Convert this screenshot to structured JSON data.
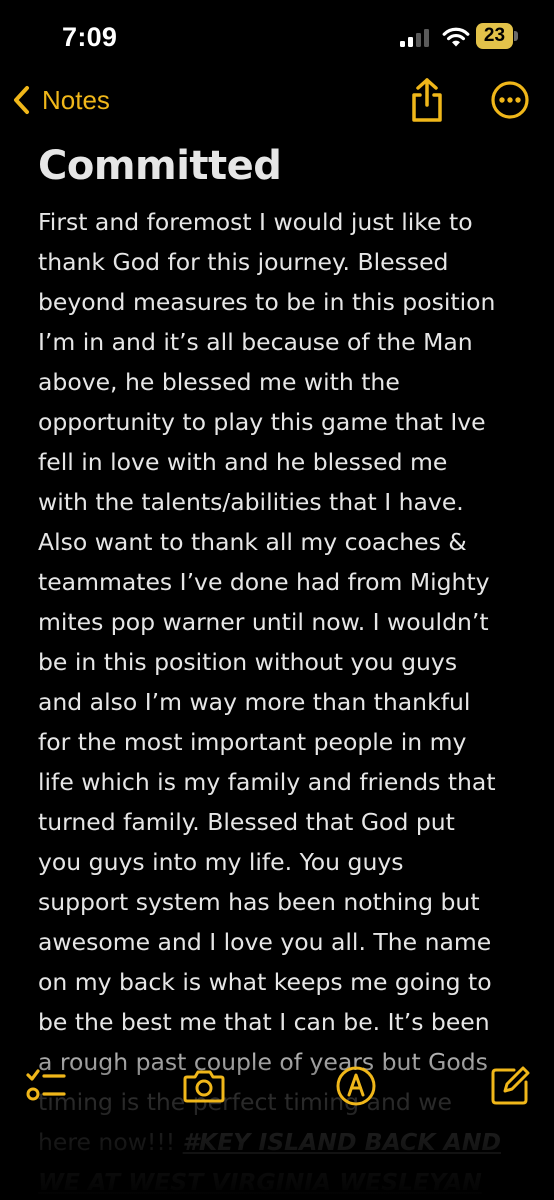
{
  "status_bar": {
    "time": "7:09",
    "battery_level": "23",
    "accent_battery": "#e3c24a"
  },
  "nav": {
    "back_label": "Notes",
    "back_icon": "chevron-left-icon",
    "share_icon": "share-icon",
    "more_icon": "ellipsis-circle-icon",
    "accent": "#f0b71a"
  },
  "note": {
    "title": "Committed",
    "lines": [
      "First and foremost I would just like to",
      "thank God for this journey. Blessed",
      "beyond measures to be in this position",
      "I’m in and it’s all because of the Man",
      "above, he blessed me with the",
      "opportunity to play this game that Ive",
      "fell in love with and he blessed me",
      "with the talents/abilities that I have.",
      "Also want to thank all my coaches &",
      "teammates I’ve done had from Mighty",
      "mites pop warner until now. I wouldn’t",
      "be in this position without you guys",
      "and also I’m way more than thankful",
      "for the most important people in my",
      "life which is my family and friends that",
      "turned family. Blessed that God put",
      "you guys into my life. You guys",
      "support system has been nothing but",
      "awesome and I love you all. The name",
      "on my back is what keeps me going to",
      "be the best me that I can be. It’s been",
      "a rough past couple of years but Gods"
    ],
    "faded_lines": [
      {
        "text": "timing is the perfect timing and we",
        "hashtag": ""
      },
      {
        "text": "here now!!! ",
        "hashtag": "#KEY ISLAND BACK AND"
      },
      {
        "text": "",
        "hashtag": "WE AT WEST VIRGINIA WESLEYAN"
      }
    ]
  },
  "toolbar": {
    "items": [
      {
        "name": "checklist-icon"
      },
      {
        "name": "camera-icon"
      },
      {
        "name": "markup-icon"
      },
      {
        "name": "compose-icon"
      }
    ]
  }
}
